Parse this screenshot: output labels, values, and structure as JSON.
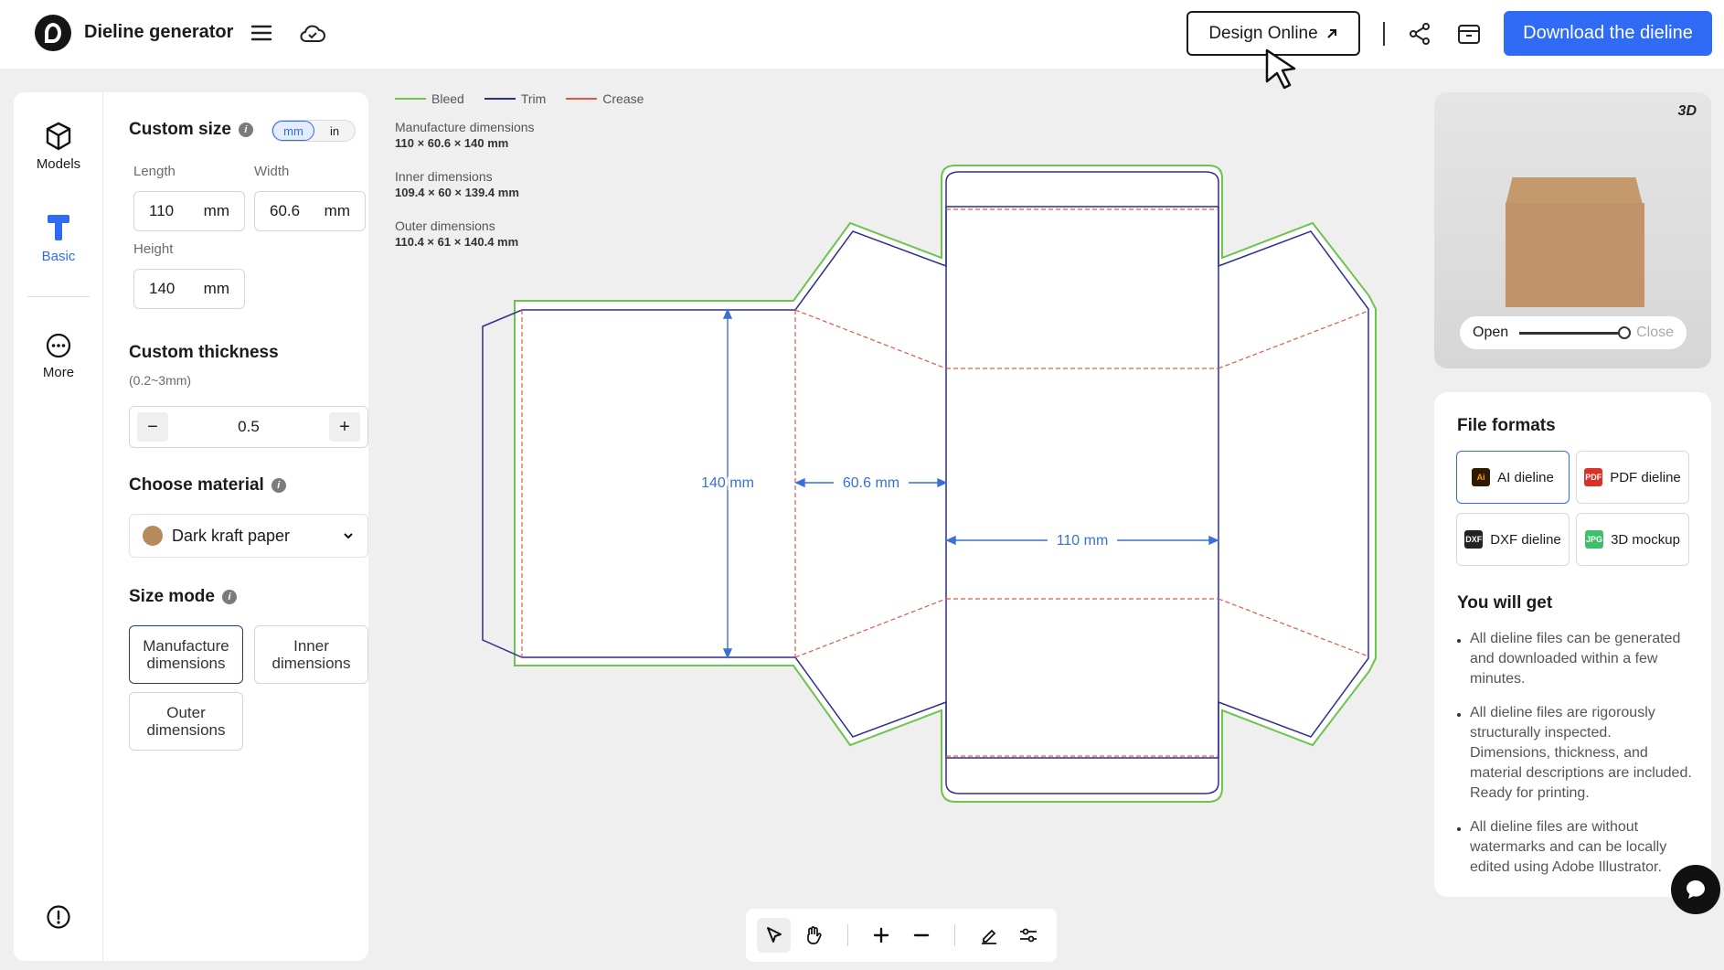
{
  "app": {
    "title": "Dieline generator"
  },
  "header": {
    "design_online": "Design Online",
    "download": "Download the dieline",
    "accent": "#2f6bf5"
  },
  "rail": {
    "models": "Models",
    "basic": "Basic",
    "more": "More"
  },
  "custom_size": {
    "title": "Custom size",
    "units": [
      "mm",
      "in"
    ],
    "length_label": "Length",
    "width_label": "Width",
    "height_label": "Height",
    "length": "110",
    "width": "60.6",
    "height": "140",
    "unit": "mm"
  },
  "thickness": {
    "title": "Custom thickness",
    "range": "(0.2~3mm)",
    "value": "0.5",
    "minus": "−",
    "plus": "+"
  },
  "material": {
    "title": "Choose material",
    "selected": "Dark kraft paper",
    "swatch_color": "#b68a5a"
  },
  "size_mode": {
    "title": "Size mode",
    "options": [
      "Manufacture dimensions",
      "Inner dimensions",
      "Outer dimensions"
    ],
    "selected": "Manufacture dimensions"
  },
  "legend": {
    "bleed": "Bleed",
    "trim": "Trim",
    "crease": "Crease",
    "bleed_color": "#6cc44f",
    "trim_color": "#2e2f8f",
    "crease_color": "#e0574a"
  },
  "dims_info": {
    "manufacture_label": "Manufacture dimensions",
    "manufacture_value": "110 × 60.6 × 140 mm",
    "inner_label": "Inner dimensions",
    "inner_value": "109.4 × 60 × 139.4 mm",
    "outer_label": "Outer dimensions",
    "outer_value": "110.4 × 61 × 140.4 mm"
  },
  "dieline_labels": {
    "height": "140 mm",
    "width": "60.6 mm",
    "length": "110 mm"
  },
  "preview": {
    "badge": "3D",
    "open": "Open",
    "close": "Close",
    "open_level": 1.0
  },
  "formats": {
    "title": "File formats",
    "items": [
      {
        "label": "AI dieline",
        "icon": "ai-icon"
      },
      {
        "label": "PDF dieline",
        "icon": "pdf-icon"
      },
      {
        "label": "DXF dieline",
        "icon": "dxf-icon"
      },
      {
        "label": "3D mockup",
        "icon": "mockup-icon"
      }
    ],
    "selected": "AI dieline"
  },
  "you_will_get": {
    "title": "You will get",
    "bullets": [
      "All dieline files can be generated and downloaded within a few minutes.",
      "All dieline files are rigorously structurally inspected. Dimensions, thickness, and material descriptions are included. Ready for printing.",
      "All dieline files are without watermarks and can be locally edited using Adobe Illustrator."
    ]
  }
}
